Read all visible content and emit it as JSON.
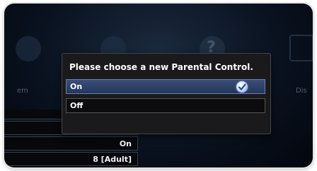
{
  "dialog": {
    "title": "Please choose a new Parental Control.",
    "options": [
      {
        "label": "On",
        "selected": true
      },
      {
        "label": "Off",
        "selected": false
      }
    ]
  },
  "background": {
    "menu_labels": [
      "em",
      "Dis"
    ]
  },
  "settings": {
    "rows": [
      {
        "value": ""
      },
      {
        "value": ""
      },
      {
        "value": "On"
      },
      {
        "value": "8 [Adult]"
      }
    ]
  },
  "colors": {
    "selected_option": "#2f4470",
    "dialog_background": "#1a1a1c",
    "screen_background": "#0a1220"
  },
  "icons": {
    "selected_marker": "checkmark-circle-icon"
  }
}
